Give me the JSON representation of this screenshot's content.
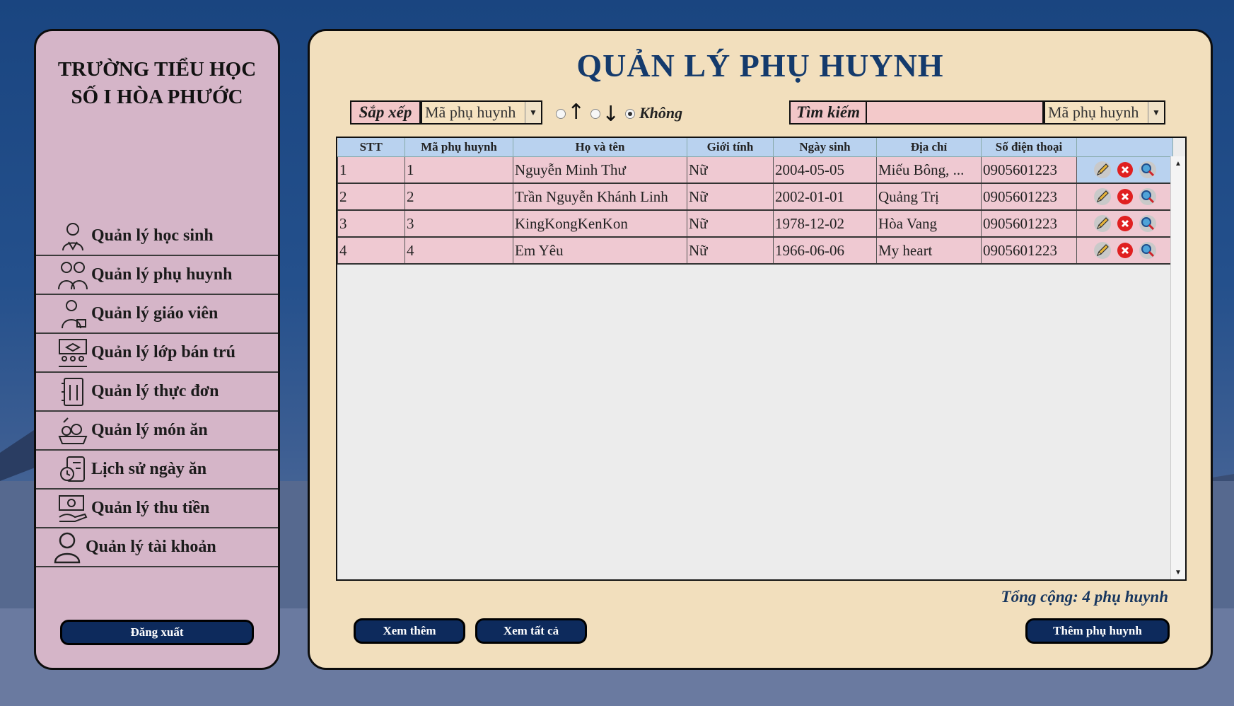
{
  "school": {
    "line1": "TRƯỜNG TIỂU HỌC",
    "line2": "SỐ I HÒA PHƯỚC"
  },
  "sidebar": {
    "items": [
      {
        "label": "Quản lý học sinh",
        "icon": "student-icon"
      },
      {
        "label": "Quản lý phụ huynh",
        "icon": "parents-icon"
      },
      {
        "label": "Quản lý giáo viên",
        "icon": "teacher-icon"
      },
      {
        "label": "Quản lý lớp bán trú",
        "icon": "classroom-icon"
      },
      {
        "label": "Quản lý thực đơn",
        "icon": "menu-book-icon"
      },
      {
        "label": "Quản lý món ăn",
        "icon": "dish-icon"
      },
      {
        "label": "Lịch sử ngày ăn",
        "icon": "history-icon"
      },
      {
        "label": "Quản lý thu tiền",
        "icon": "payment-icon"
      },
      {
        "label": "Quản lý tài khoản",
        "icon": "account-icon"
      }
    ],
    "logout_label": "Đăng xuất"
  },
  "main": {
    "title": "QUẢN LÝ PHỤ HUYNH",
    "sort": {
      "label": "Sắp xếp",
      "field": "Mã phụ huynh",
      "asc_glyph": "↑",
      "desc_glyph": "↓",
      "none_label": "Không",
      "selected": "none"
    },
    "search": {
      "label": "Tìm kiếm",
      "value": "",
      "field": "Mã phụ huynh"
    },
    "table": {
      "columns": [
        "STT",
        "Mã phụ huynh",
        "Họ và tên",
        "Giới tính",
        "Ngày sinh",
        "Địa chỉ",
        "Số điện thoại",
        ""
      ],
      "rows": [
        [
          "1",
          "1",
          "Nguyễn Minh Thư",
          "Nữ",
          "2004-05-05",
          "Miếu Bông, ...",
          "0905601223"
        ],
        [
          "2",
          "2",
          "Trần Nguyễn Khánh Linh",
          "Nữ",
          "2002-01-01",
          "Quảng Trị",
          "0905601223"
        ],
        [
          "3",
          "3",
          "KingKongKenKon",
          "Nữ",
          "1978-12-02",
          "Hòa Vang",
          "0905601223"
        ],
        [
          "4",
          "4",
          "Em Yêu",
          "Nữ",
          "1966-06-06",
          "My heart",
          "0905601223"
        ]
      ]
    },
    "total_text": "Tổng cộng: 4 phụ huynh",
    "buttons": {
      "see_more": "Xem thêm",
      "see_all": "Xem tất cả",
      "add_parent": "Thêm phụ huynh"
    }
  },
  "colors": {
    "sidebar_bg": "#d5b5c8",
    "main_bg": "#f2dfbd",
    "button_bg": "#0d2a5c",
    "header_bg": "#b9d2ef",
    "row_bg": "#efc9d2",
    "title": "#143a6c"
  }
}
